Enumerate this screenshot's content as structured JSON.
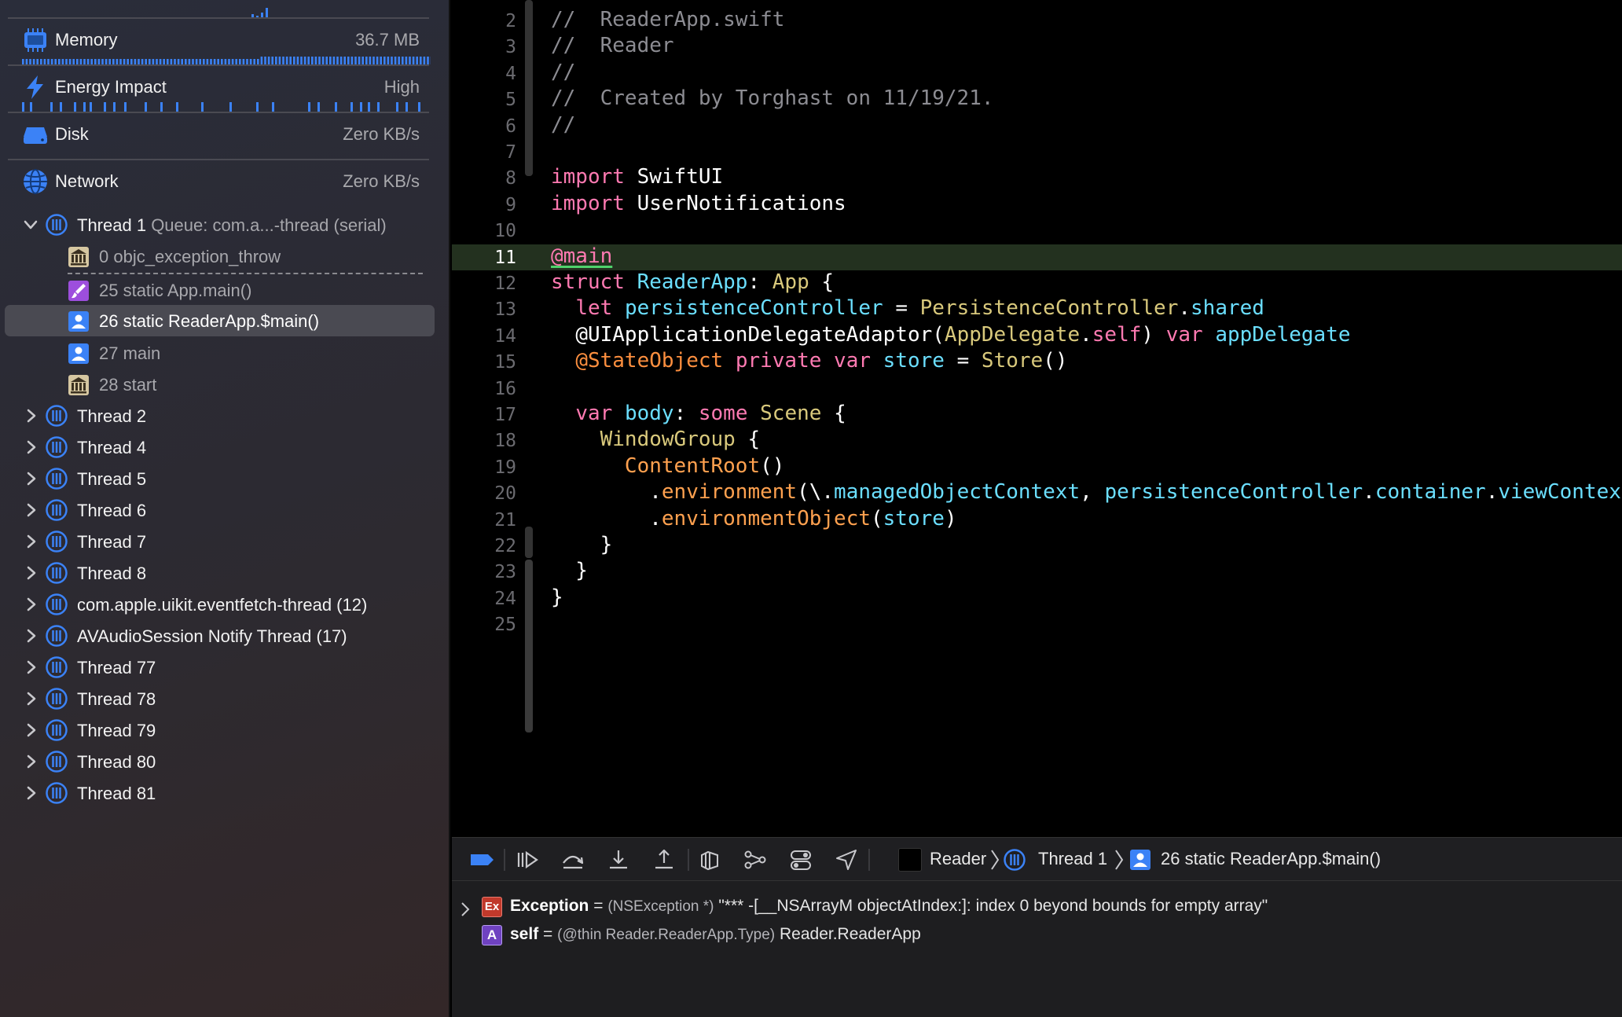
{
  "navigator": {
    "gauges": [
      {
        "label": "Memory",
        "value": "36.7 MB"
      },
      {
        "label": "Energy Impact",
        "value": "High"
      },
      {
        "label": "Disk",
        "value": "Zero KB/s"
      },
      {
        "label": "Network",
        "value": "Zero KB/s"
      }
    ],
    "thread1": {
      "name": "Thread 1",
      "queue": "Queue: com.a...-thread (serial)"
    },
    "frames": [
      "0 objc_exception_throw",
      "25 static App.main()",
      "26 static ReaderApp.$main()",
      "27 main",
      "28 start"
    ],
    "threads": [
      "Thread 2",
      "Thread 4",
      "Thread 5",
      "Thread 6",
      "Thread 7",
      "Thread 8",
      "com.apple.uikit.eventfetch-thread (12)",
      "AVAudioSession Notify Thread (17)",
      "Thread 77",
      "Thread 78",
      "Thread 79",
      "Thread 80",
      "Thread 81"
    ]
  },
  "editor": {
    "current_line": "11",
    "lines": [
      {
        "n": "2",
        "t": "//  ReaderApp.swift"
      },
      {
        "n": "3",
        "t": "//  Reader"
      },
      {
        "n": "4",
        "t": "//"
      },
      {
        "n": "5",
        "t": "//  Created by Torghast on 11/19/21."
      },
      {
        "n": "6",
        "t": "//"
      },
      {
        "n": "7",
        "t": ""
      },
      {
        "n": "8",
        "t": "import SwiftUI"
      },
      {
        "n": "9",
        "t": "import UserNotifications"
      },
      {
        "n": "10",
        "t": ""
      },
      {
        "n": "11",
        "t": "@main"
      },
      {
        "n": "12",
        "t": "struct ReaderApp: App {"
      },
      {
        "n": "13",
        "t": "  let persistenceController = PersistenceController.shared"
      },
      {
        "n": "14",
        "t": "  @UIApplicationDelegateAdaptor(AppDelegate.self) var appDelegate"
      },
      {
        "n": "15",
        "t": "  @StateObject private var store = Store()"
      },
      {
        "n": "16",
        "t": ""
      },
      {
        "n": "17",
        "t": "  var body: some Scene {"
      },
      {
        "n": "18",
        "t": "    WindowGroup {"
      },
      {
        "n": "19",
        "t": "      ContentRoot()"
      },
      {
        "n": "20",
        "t": "        .environment(\\.managedObjectContext, persistenceController.container.viewContext)"
      },
      {
        "n": "21",
        "t": "        .environmentObject(store)"
      },
      {
        "n": "22",
        "t": "    }"
      },
      {
        "n": "23",
        "t": "  }"
      },
      {
        "n": "24",
        "t": "}"
      },
      {
        "n": "25",
        "t": ""
      }
    ]
  },
  "debug_bar": {
    "breadcrumb": [
      "Reader",
      "Thread 1",
      "26 static ReaderApp.$main()"
    ]
  },
  "variables": [
    {
      "badge": "Ex",
      "name": "Exception",
      "eq": "=",
      "type": "(NSException *)",
      "value": "\"*** -[__NSArrayM objectAtIndex:]: index 0 beyond bounds for empty array\""
    },
    {
      "badge": "A",
      "name": "self",
      "eq": "=",
      "type": "(@thin Reader.ReaderApp.Type)",
      "value": "Reader.ReaderApp"
    }
  ],
  "colors": {
    "accent": "#3b82f6",
    "current_line_bg": "#23311f",
    "keyword": "#ff7ab2",
    "comment": "#8c8c92"
  }
}
